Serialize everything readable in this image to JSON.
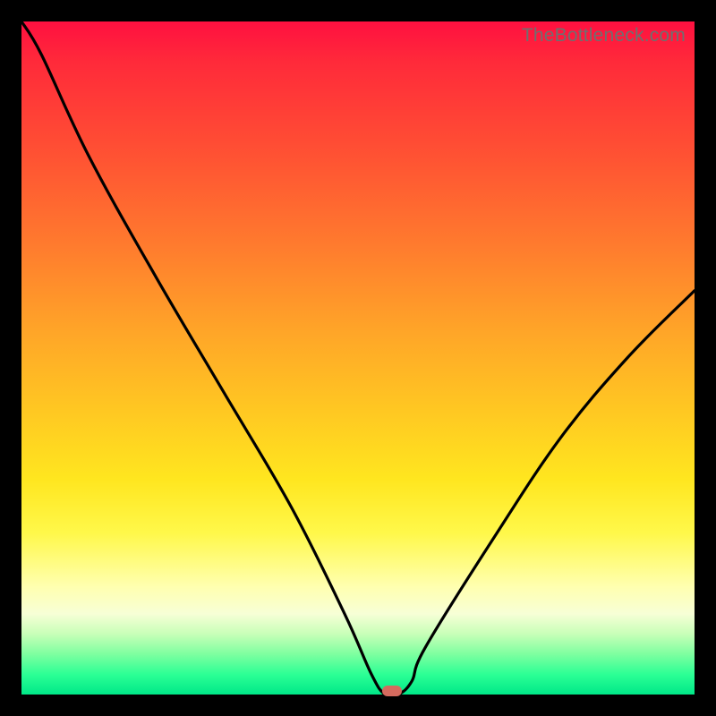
{
  "watermark": "TheBottleneck.com",
  "colors": {
    "gradient_top": "#ff1040",
    "gradient_bottom": "#00e888",
    "curve": "#000000",
    "marker": "#d46a5e",
    "frame": "#000000"
  },
  "chart_data": {
    "type": "line",
    "title": "",
    "xlabel": "",
    "ylabel": "",
    "xlim": [
      0,
      100
    ],
    "ylim": [
      0,
      100
    ],
    "x": [
      0,
      3,
      10,
      20,
      30,
      40,
      48,
      52,
      54,
      56,
      58,
      60,
      70,
      80,
      90,
      100
    ],
    "values": [
      100,
      95,
      80,
      62,
      45,
      28,
      12,
      3,
      0,
      0,
      2,
      7,
      23,
      38,
      50,
      60
    ],
    "series": [
      {
        "name": "bottleneck-curve",
        "values": [
          100,
          95,
          80,
          62,
          45,
          28,
          12,
          3,
          0,
          0,
          2,
          7,
          23,
          38,
          50,
          60
        ]
      }
    ],
    "marker": {
      "x": 55,
      "y": 0
    },
    "grid": false,
    "legend": false
  }
}
